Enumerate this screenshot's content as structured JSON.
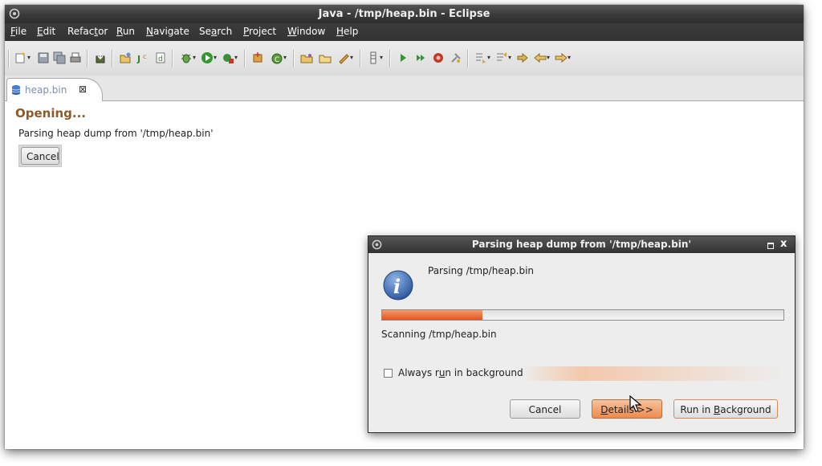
{
  "window": {
    "title": "Java - /tmp/heap.bin - Eclipse"
  },
  "menubar": {
    "items": [
      {
        "pre": "",
        "key": "F",
        "post": "ile"
      },
      {
        "pre": "",
        "key": "E",
        "post": "dit"
      },
      {
        "pre": "Refac",
        "key": "t",
        "post": "or"
      },
      {
        "pre": "",
        "key": "R",
        "post": "un"
      },
      {
        "pre": "",
        "key": "N",
        "post": "avigate"
      },
      {
        "pre": "Se",
        "key": "a",
        "post": "rch"
      },
      {
        "pre": "",
        "key": "P",
        "post": "roject"
      },
      {
        "pre": "",
        "key": "W",
        "post": "indow"
      },
      {
        "pre": "",
        "key": "H",
        "post": "elp"
      }
    ]
  },
  "editor_tab": {
    "label": "heap.bin",
    "close_glyph": "⊠"
  },
  "editor": {
    "title": "Opening...",
    "message": "Parsing heap dump from '/tmp/heap.bin'",
    "cancel_label": "Cancel"
  },
  "dialog": {
    "title": "Parsing heap dump from '/tmp/heap.bin'",
    "message": "Parsing /tmp/heap.bin",
    "progress": 0.25,
    "status": "Scanning /tmp/heap.bin",
    "checkbox": {
      "pre": "Always r",
      "key": "u",
      "post": "n in background",
      "checked": false
    },
    "cancel_label": "Cancel",
    "details": {
      "pre": "",
      "key": "D",
      "post": "etails >>"
    },
    "run_bg": {
      "pre": "Run in ",
      "key": "B",
      "post": "ackground"
    },
    "close_glyph": "x"
  },
  "colors": {
    "accent_orange": "#e4541c",
    "title_brown": "#8b5a2b"
  }
}
